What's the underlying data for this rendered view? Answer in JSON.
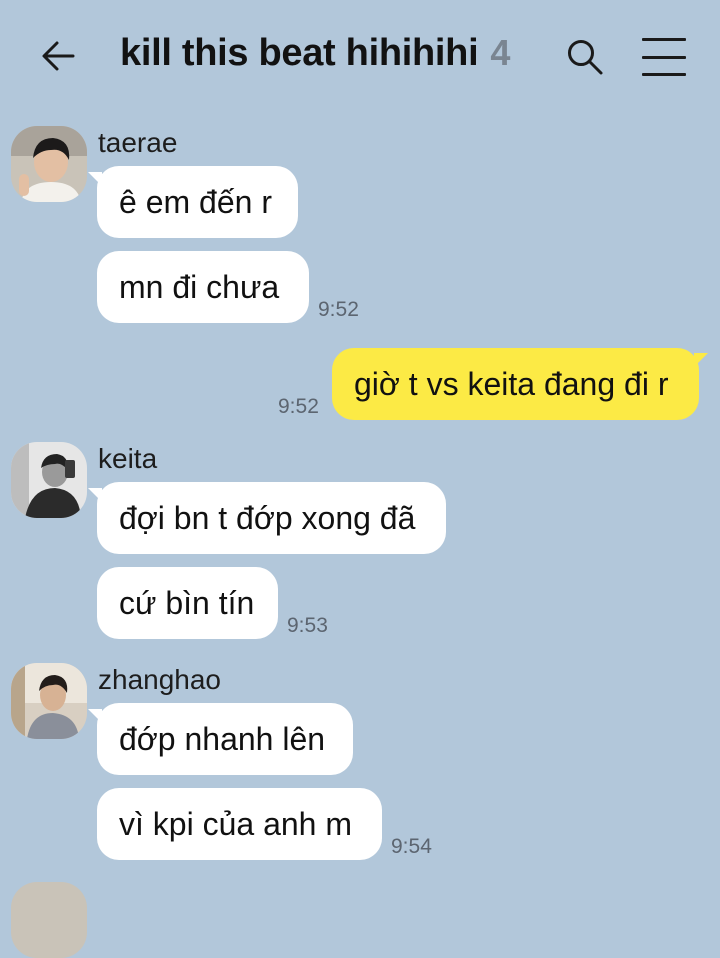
{
  "header": {
    "title": "kill this beat hihihihi",
    "member_count": "4",
    "back_icon": "arrow-left-icon",
    "search_icon": "search-icon",
    "menu_icon": "hamburger-menu-icon"
  },
  "colors": {
    "background": "#b2c7da",
    "incoming_bubble": "#ffffff",
    "outgoing_bubble": "#fcea45"
  },
  "messages": [
    {
      "sender": "taerae",
      "bubbles": [
        "ê em đến r",
        "mn đi chưa"
      ],
      "time": "9:52"
    },
    {
      "sender": "me",
      "bubbles": [
        "giờ t vs keita đang đi r"
      ],
      "time": "9:52"
    },
    {
      "sender": "keita",
      "bubbles": [
        "đợi bn t đớp xong đã",
        "cứ bìn tín"
      ],
      "time": "9:53"
    },
    {
      "sender": "zhanghao",
      "bubbles": [
        "đớp nhanh lên",
        "vì kpi của anh m"
      ],
      "time": "9:54"
    }
  ]
}
